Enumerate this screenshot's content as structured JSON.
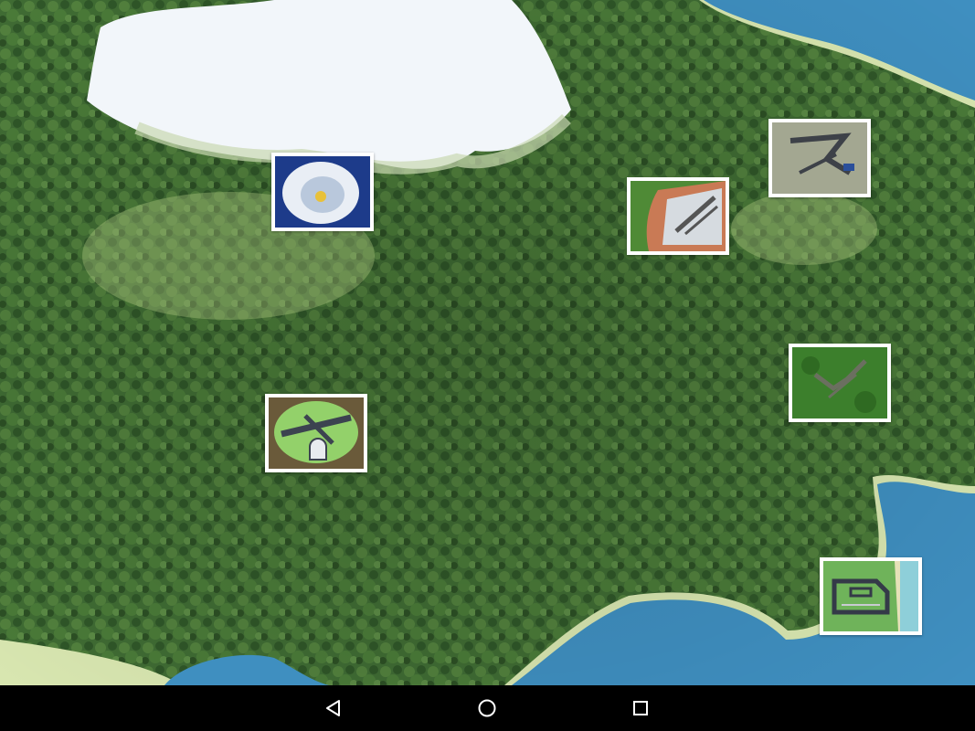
{
  "map": {
    "icon": "island-terrain-map",
    "colors": {
      "forest": "#3f6b33",
      "forest_dark": "#2c4f24",
      "snow": "#f2f6fa",
      "sea": "#3f8fc0",
      "beach": "#d8e6b0"
    }
  },
  "airfields": [
    {
      "id": "snow-airfield",
      "icon": "snow-crater-airfield-thumbnail"
    },
    {
      "id": "rock-runway",
      "icon": "rocky-runway-thumbnail"
    },
    {
      "id": "mountain-base",
      "icon": "mountain-base-thumbnail"
    },
    {
      "id": "forest-strip",
      "icon": "forest-strip-thumbnail"
    },
    {
      "id": "green-airport",
      "icon": "green-airport-thumbnail"
    },
    {
      "id": "coastal-base",
      "icon": "coastal-base-thumbnail"
    }
  ],
  "navigation": {
    "back": "back-icon",
    "home": "home-icon",
    "recents": "recents-icon"
  }
}
